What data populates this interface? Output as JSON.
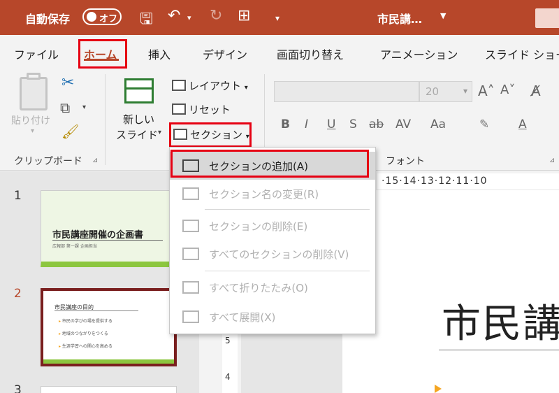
{
  "titlebar": {
    "autosave_label": "自動保存",
    "toggle_state": "オフ",
    "doc_title": "市民講…",
    "icons": [
      "save-icon",
      "undo-icon",
      "redo-icon",
      "present-icon",
      "customize-icon"
    ]
  },
  "tabs": [
    {
      "label": "ファイル"
    },
    {
      "label": "ホーム"
    },
    {
      "label": "挿入"
    },
    {
      "label": "デザイン"
    },
    {
      "label": "画面切り替え"
    },
    {
      "label": "アニメーション"
    },
    {
      "label": "スライド ショー"
    }
  ],
  "ribbon": {
    "paste_label": "貼り付け",
    "clipboard_group": "クリップボード",
    "new_slide_line1": "新しい",
    "new_slide_line2": "スライド",
    "layout_label": "レイアウト",
    "reset_label": "リセット",
    "section_label": "セクション",
    "font_group": "フォント",
    "font_size": "20",
    "format_buttons": [
      "B",
      "I",
      "U",
      "S",
      "ab",
      "AV",
      "Aa",
      "A"
    ]
  },
  "section_menu": {
    "items": [
      {
        "label": "セクションの追加(A)",
        "enabled": true
      },
      {
        "label": "セクション名の変更(R)",
        "enabled": false
      },
      {
        "label": "セクションの削除(E)",
        "enabled": false
      },
      {
        "label": "すべてのセクションの削除(V)",
        "enabled": false
      },
      {
        "label": "すべて折りたたみ(O)",
        "enabled": false
      },
      {
        "label": "すべて展開(X)",
        "enabled": false
      }
    ]
  },
  "slides": [
    {
      "number": "1",
      "title": "市民講座開催の企画書",
      "subtitle": "広報部 第一課 企画担当"
    },
    {
      "number": "2",
      "title": "市民講座の目的",
      "bullets": [
        "市民の学びの場を提供する",
        "地域のつながりをつくる",
        "生涯学習への関心を高める"
      ]
    },
    {
      "number": "3"
    }
  ],
  "editor": {
    "ruler_h": "·15·14·13·12·11·10",
    "ruler_v": [
      "5",
      "4"
    ],
    "slide_title": "市民講"
  },
  "colors": {
    "accent": "#b7472a",
    "highlight": "#e60012",
    "slide_green": "#8cc63f"
  }
}
